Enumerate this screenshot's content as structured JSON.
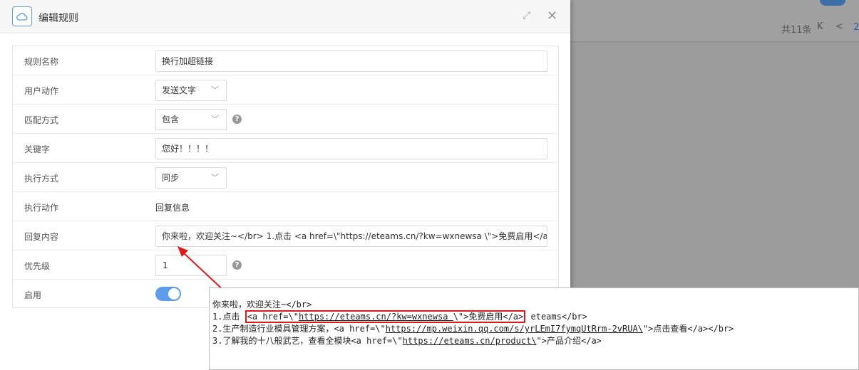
{
  "background": {
    "pager": {
      "total": "共11条",
      "first": "K",
      "prev": "<",
      "page": "2"
    }
  },
  "dialog": {
    "title": "编辑规则",
    "icon": "cloud-icon",
    "accent_color": "#5d9cec"
  },
  "form": {
    "rule_name": {
      "label": "规则名称",
      "value": "换行加超链接"
    },
    "user_action": {
      "label": "用户动作",
      "value": "发送文字"
    },
    "match_mode": {
      "label": "匹配方式",
      "value": "包含"
    },
    "keyword": {
      "label": "关键字",
      "value": "您好！！！！"
    },
    "exec_mode": {
      "label": "执行方式",
      "value": "同步"
    },
    "exec_action": {
      "label": "执行动作",
      "value": "回复信息"
    },
    "reply_content": {
      "label": "回复内容",
      "value": "你来啦，欢迎关注~</br> 1.点击 <a href=\\\"https://eteams.cn/?kw=wxnewsa \\\">免费启用</a> eteams</br>"
    },
    "priority": {
      "label": "优先级",
      "value": "1"
    },
    "enabled": {
      "label": "启用",
      "on": true
    }
  },
  "callout": {
    "line1": "你来啦，欢迎关注~</br>",
    "line2_prefix": "1.点击 ",
    "line2_tag_open": "<a href=\\\"",
    "line2_url": "https://eteams.cn/?kw=wxnewsa ",
    "line2_tag_mid": "\\\">免费启用</a>",
    "line2_suffix": " eteams</br>",
    "line3_prefix": "2.生产制造行业模具管理方案，<a href=\\\"",
    "line3_url": "https://mp.weixin.qq.com/s/yrLEmI7fymqUtRrm-2vRUA\\",
    "line3_suffix": "\">点击查看</a></br>",
    "line4_prefix": "3.了解我的十八般武艺，查看全模块<a href=\\\"",
    "line4_url": "https://eteams.cn/product\\",
    "line4_suffix": "\">产品介绍</a>"
  }
}
